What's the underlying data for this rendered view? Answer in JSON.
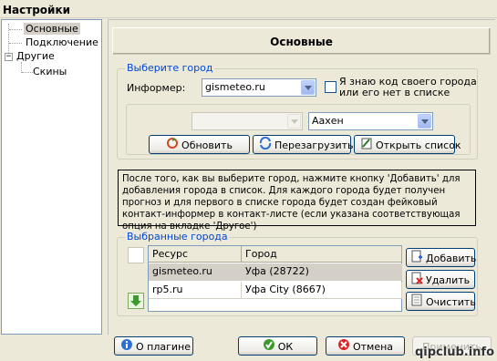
{
  "window": {
    "title": "Настройки"
  },
  "tree": {
    "items": [
      {
        "label": "Основные",
        "selected": true
      },
      {
        "label": "Подключение"
      },
      {
        "label": "Другие",
        "expanded": true
      },
      {
        "label": "Скины"
      }
    ]
  },
  "header": {
    "title": "Основные"
  },
  "city_group": {
    "legend": "Выберите город",
    "informer_label": "Информер:",
    "informer_value": "gismeteo.ru",
    "know_code_label_1": "Я знаю код своего города",
    "know_code_label_2": "или его нет в списке",
    "know_code_checked": false,
    "country_value": "",
    "city_value": "Аахен",
    "refresh_label": "Обновить",
    "reload_label": "Перезагрузить",
    "open_list_label": "Открыть список"
  },
  "info_text": "После того, как вы выберите город, нажмите кнопку 'Добавить' для добавления города в список. Для каждого города будет получен прогноз и для первого в списке города будет создан фейковый контакт-информер в контакт-листе (если указана соответствующая опция на вкладке 'Другое')",
  "selected_group": {
    "legend": "Выбранные города",
    "columns": [
      "Ресурс",
      "Город"
    ],
    "rows": [
      {
        "resource": "gismeteo.ru",
        "city": "Уфа (28722)",
        "selected": true
      },
      {
        "resource": "rp5.ru",
        "city": "Уфа City (8667)"
      }
    ],
    "add_label": "Добавить",
    "delete_label": "Удалить",
    "clear_label": "Очистить"
  },
  "footer": {
    "about_label": "О плагине",
    "ok_label": "ОК",
    "cancel_label": "Отмена",
    "apply_label": "Применить"
  },
  "watermark": "qipclub.info",
  "colors": {
    "legend": "#0046d5",
    "button_border": "#003c74",
    "selection": "#d4d0c8"
  }
}
